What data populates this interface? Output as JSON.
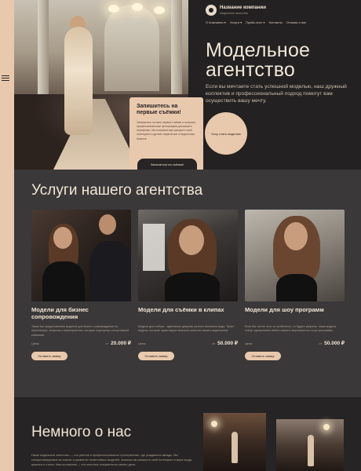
{
  "header": {
    "company_name": "Название компании",
    "company_sub": "Модельное агентство",
    "nav": [
      "О Компании ▾",
      "Услуги ▾",
      "Прайс-лист ▾",
      "Контакты",
      "Отзывы о нас"
    ]
  },
  "hero": {
    "title": "Модельное агентство",
    "description": "Если вы мечтаете стать успешной моделью, наш дружный коллектив и профессиональный подход помогут вам осуществить вашу мечту.",
    "circle_button": "Хочу стать моделью"
  },
  "cta_card": {
    "title": "Запишитесь на первые съёмки!",
    "text": "Запишитесь на свои первые съёмки и получите профессиональные фотографии для вашего портфолио. Мы поможем вам раскрыть свой потенциал и сделать первый шаг в модельном бизнесе.",
    "button": "Записаться на съёмки!"
  },
  "services": {
    "heading": "Услуги нашего агентства",
    "cards": [
      {
        "title": "Модели для бизнес сопровождения",
        "text": "Также мы предоставляем моделей для бизнес сопровождения на переговорах, встречах и мероприятиях, которые подчеркнут статус вашей компании.",
        "price_label": "Цена:",
        "price_prefix": "от",
        "price": "20.000 ₽",
        "button": "Оставить заявку"
      },
      {
        "title": "Модели для съёмки в клипах",
        "text": "Модели для съёмок - идеальные девушки разного внешнего вида. Также модели, которые гарантируют высокое качество вашего видеоклипа.",
        "price_label": "Цена:",
        "price_prefix": "от",
        "price": "50.000 ₽",
        "button": "Оставить заявку"
      },
      {
        "title": "Модели для шоу программ",
        "text": "Если Вы хотите чего-то особенного, то будьте уверены, наши модели станут украшением любого вашего мероприятия и шоу программы.",
        "price_label": "Цена:",
        "price_prefix": "от",
        "price": "50.000 ₽",
        "button": "Оставить заявку"
      }
    ]
  },
  "about": {
    "heading": "Немного о нас",
    "text": "Наше модельное агентство — это уютное и профессиональное пространство, где рождаются звезды. Мы специализируемся на поиске и развитии талантливых моделей, помогая им раскрыть свой потенциал в мире моды, красоты и стиля. Наш коллектив — это опытные специалисты своего дела."
  },
  "colors": {
    "accent": "#e9c9ae",
    "background": "#262424",
    "section_bg": "#3a3838",
    "text_light": "#f1e6d8"
  }
}
